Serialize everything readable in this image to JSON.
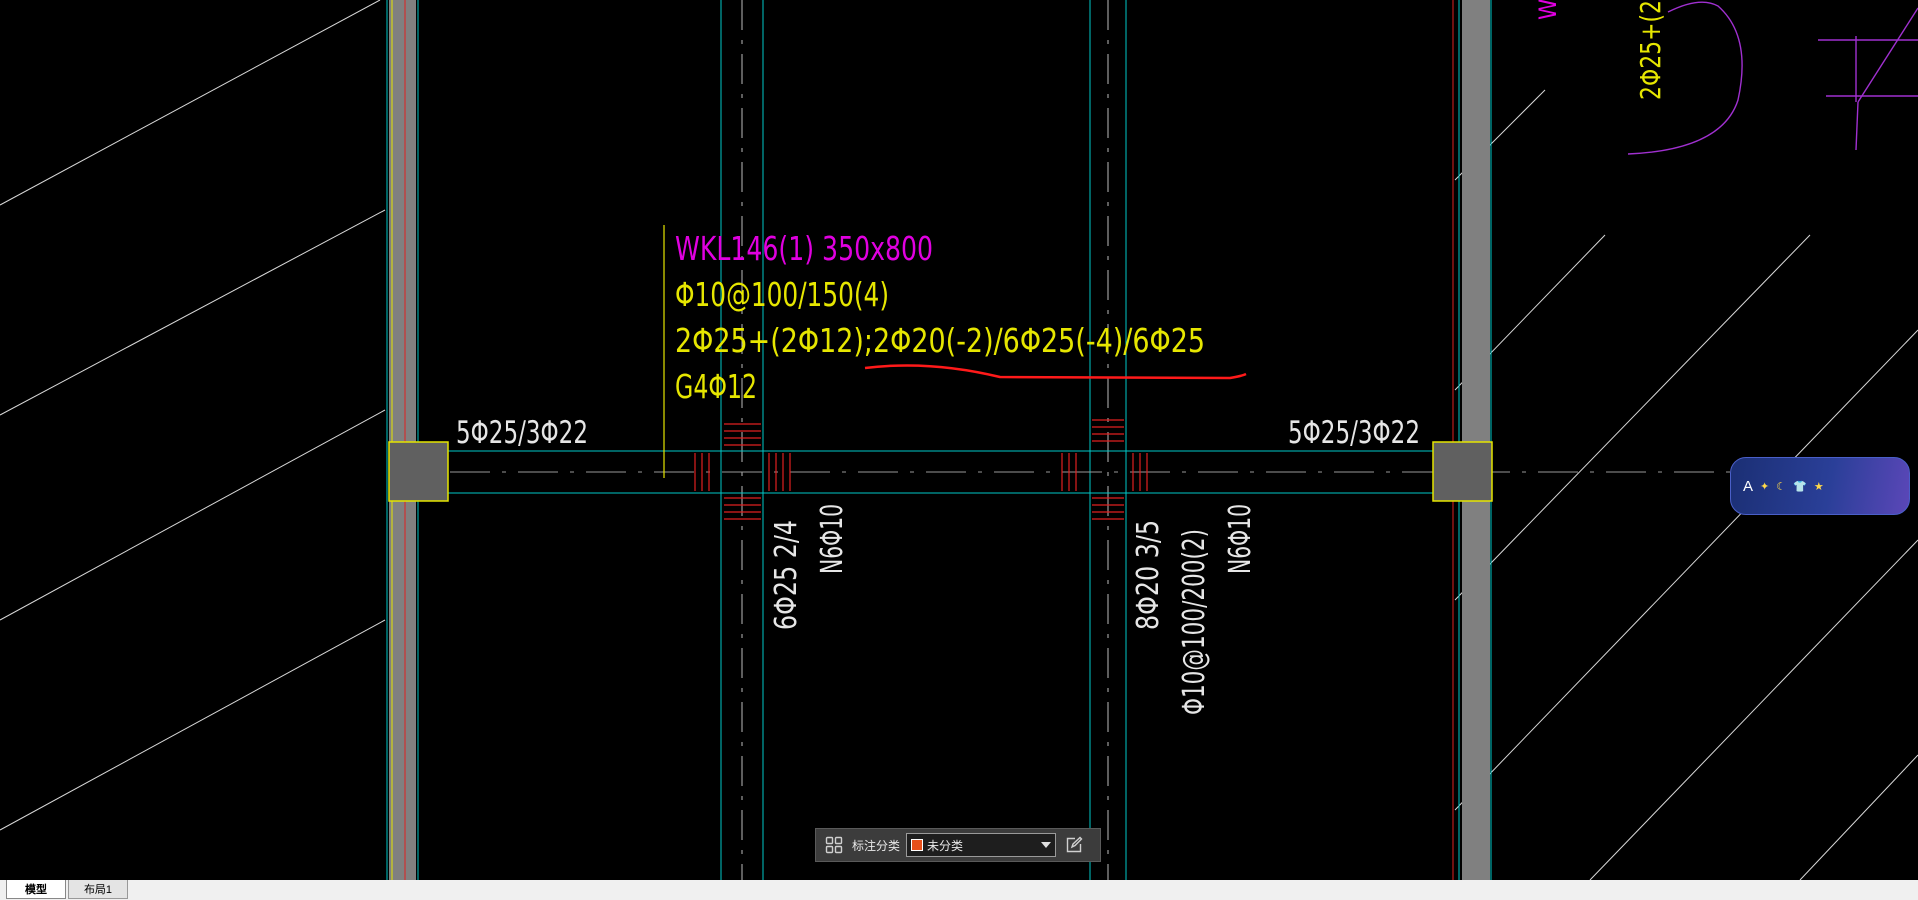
{
  "drawing": {
    "beam_label": {
      "line1": "WKL146(1) 350x800",
      "line2": "Φ10@100/150(4)",
      "line3": "2Φ25+(2Φ12);2Φ20(-2)/6Φ25(-4)/6Φ25",
      "line4": "G4Φ12"
    },
    "support_left_rebar": "5Φ25/3Φ22",
    "support_right_rebar": "5Φ25/3Φ22",
    "beam_a_bottom": "6Φ25 2/4",
    "beam_a_side": "N6Φ10",
    "beam_b_bottom": "8Φ20 3/5",
    "beam_b_stirrup": "Φ10@100/200(2)",
    "beam_b_side": "N6Φ10",
    "edge_label_top": "2Φ25+(2",
    "edge_label_letter": "W",
    "colors": {
      "label_magenta": "#e000e0",
      "label_yellow": "#e6e600",
      "grid_cyan": "#00c8c8",
      "column_gray": "#808080",
      "markup_red": "#ff1a1a"
    }
  },
  "toolbar": {
    "grid_icon": "grid-icon",
    "label": "标注分类",
    "category_value": "未分类",
    "category_color": "#e8501a",
    "edit_icon": "edit-icon"
  },
  "tabs": [
    "模型",
    "布局1"
  ],
  "widget": {
    "letter": "A",
    "icons": [
      "sparkle-icon",
      "moon-icon",
      "shirt-icon",
      "star-icon"
    ]
  }
}
